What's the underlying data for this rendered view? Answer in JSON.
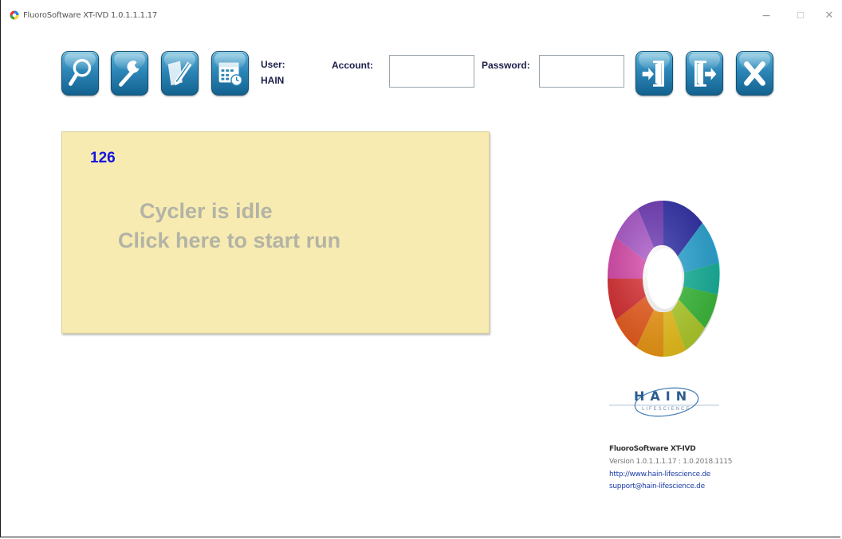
{
  "window": {
    "title": "FluoroSoftware XT-IVD 1.0.1.1.1.17",
    "controls": {
      "minimize": "−",
      "maximize": "☐",
      "close": "✕"
    }
  },
  "toolbar": {
    "buttons": [
      {
        "name": "search",
        "icon": "magnifier-icon"
      },
      {
        "name": "tools",
        "icon": "wrench-icon"
      },
      {
        "name": "edit",
        "icon": "pencil-icon"
      },
      {
        "name": "calendar",
        "icon": "calendar-clock-icon"
      },
      {
        "name": "login",
        "icon": "login-door-icon"
      },
      {
        "name": "logout",
        "icon": "logout-door-icon"
      },
      {
        "name": "exit",
        "icon": "close-x-icon"
      }
    ],
    "user_label": "User:",
    "user_value": "HAIN",
    "account_label": "Account:",
    "account_value": "",
    "password_label": "Password:",
    "password_value": ""
  },
  "status_panel": {
    "run_count": "126",
    "line1": "Cycler is idle",
    "line2": "Click here to start run"
  },
  "branding": {
    "company": "HAIN",
    "company_sub": "LIFESCIENCE",
    "product": "FluoroSoftware XT-IVD",
    "version": "Version 1.0.1.1.1.17 : 1.0.2018.1115",
    "url": "http://www.hain-lifescience.de",
    "email": "support@hain-lifescience.de"
  },
  "colors": {
    "button_blue": "#2c86b8",
    "panel_yellow": "#f7ebb1",
    "count_blue": "#1414e0",
    "status_gray": "#b3b3a6",
    "link_blue": "#1c3fa8"
  }
}
